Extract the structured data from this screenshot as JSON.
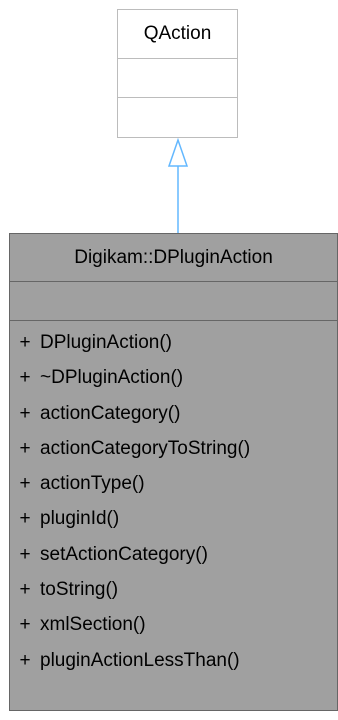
{
  "parent_class": {
    "name": "QAction",
    "attributes": [],
    "methods": []
  },
  "inheritance": {
    "from": "Digikam::DPluginAction",
    "to": "QAction",
    "arrow_color": "#63b8ff"
  },
  "child_class": {
    "name": "Digikam::DPluginAction",
    "attributes": [],
    "methods": [
      {
        "visibility": "+",
        "name": "DPluginAction()"
      },
      {
        "visibility": "+",
        "name": "~DPluginAction()"
      },
      {
        "visibility": "+",
        "name": "actionCategory()"
      },
      {
        "visibility": "+",
        "name": "actionCategoryToString()"
      },
      {
        "visibility": "+",
        "name": "actionType()"
      },
      {
        "visibility": "+",
        "name": "pluginId()"
      },
      {
        "visibility": "+",
        "name": "setActionCategory()"
      },
      {
        "visibility": "+",
        "name": "toString()"
      },
      {
        "visibility": "+",
        "name": "xmlSection()"
      },
      {
        "visibility": "+",
        "name": "pluginActionLessThan()"
      }
    ]
  },
  "colors": {
    "parent_border": "#bcbcbc",
    "child_fill": "#a0a0a0",
    "child_border": "#666666",
    "arrow": "#63b8ff"
  }
}
